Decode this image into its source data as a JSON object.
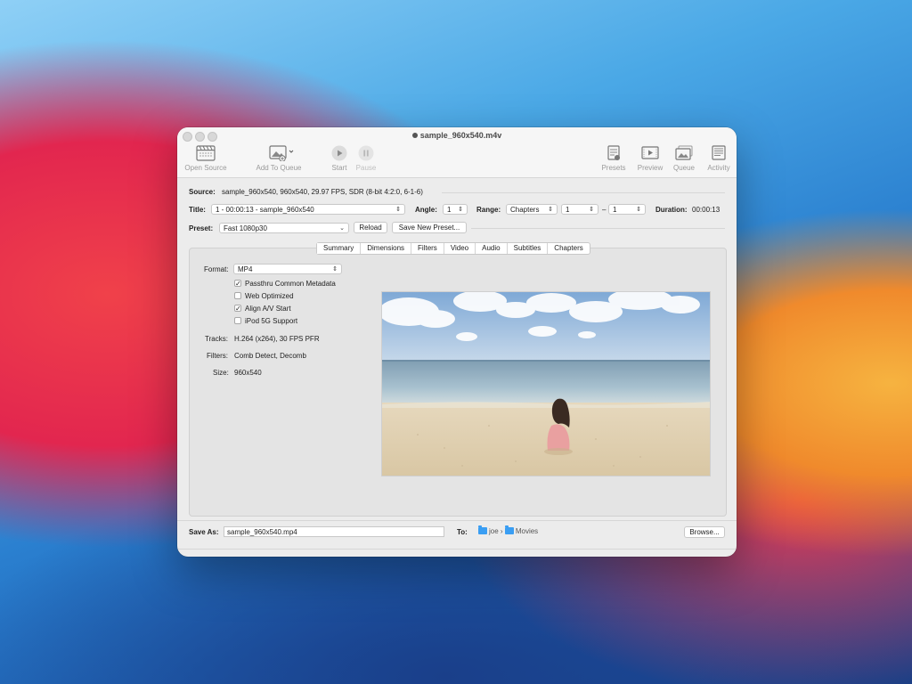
{
  "window": {
    "title": "sample_960x540.m4v"
  },
  "toolbar": {
    "open_source": "Open Source",
    "add_to_queue": "Add To Queue",
    "start": "Start",
    "pause": "Pause",
    "presets": "Presets",
    "preview": "Preview",
    "queue": "Queue",
    "activity": "Activity"
  },
  "source": {
    "label": "Source:",
    "value": "sample_960x540, 960x540, 29.97 FPS, SDR (8-bit 4:2:0, 6-1-6)"
  },
  "title_row": {
    "title_label": "Title:",
    "title_value": "1 - 00:00:13 - sample_960x540",
    "angle_label": "Angle:",
    "angle_value": "1",
    "range_label": "Range:",
    "range_value": "Chapters",
    "range_start": "1",
    "range_dash": "–",
    "range_end": "1",
    "duration_label": "Duration:",
    "duration_value": "00:00:13"
  },
  "preset": {
    "label": "Preset:",
    "value": "Fast 1080p30",
    "reload": "Reload",
    "save_new": "Save New Preset..."
  },
  "tabs": [
    "Summary",
    "Dimensions",
    "Filters",
    "Video",
    "Audio",
    "Subtitles",
    "Chapters"
  ],
  "summary": {
    "format_label": "Format:",
    "format_value": "MP4",
    "options": [
      {
        "label": "Passthru Common Metadata",
        "checked": true
      },
      {
        "label": "Web Optimized",
        "checked": false
      },
      {
        "label": "Align A/V Start",
        "checked": true
      },
      {
        "label": "iPod 5G Support",
        "checked": false
      }
    ],
    "tracks_label": "Tracks:",
    "tracks_value": "H.264 (x264), 30 FPS PFR",
    "filters_label": "Filters:",
    "filters_value": "Comb Detect, Decomb",
    "size_label": "Size:",
    "size_value": "960x540"
  },
  "save": {
    "label": "Save As:",
    "filename": "sample_960x540.mp4",
    "to_label": "To:",
    "path": [
      "joe",
      "Movies"
    ],
    "path_sep": "›",
    "browse": "Browse..."
  },
  "check_glyph": "✓"
}
